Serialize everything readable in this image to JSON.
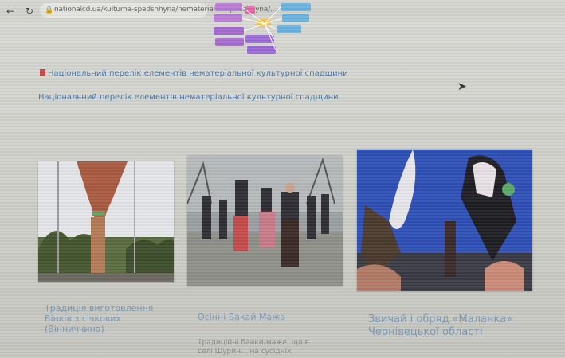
{
  "browser": {
    "url": "nationalcd.ua/kulturna-spadshhyna/nematerialna-spadshhyna/..."
  },
  "links": {
    "national_list": "Національний перелік елементів нематеріальної культурної спадщини",
    "national_list_2": "Національний перелік елементів нематеріальної культурної спадщини"
  },
  "cards": [
    {
      "title": "Традиція виготовлення Вінків з січкових (Вінниччина)",
      "desc": ""
    },
    {
      "title": "Осінні Бакай Мажа",
      "desc": "Традиційні байки-маже, що в селі Шурин... на сусідніх"
    },
    {
      "title": "Звичай і обряд «Маланка» Чернівецької області",
      "desc": ""
    }
  ],
  "colors": {
    "link": "#4a78a8",
    "card_title": "#7a97b5",
    "bg": "#d2d2cd"
  }
}
